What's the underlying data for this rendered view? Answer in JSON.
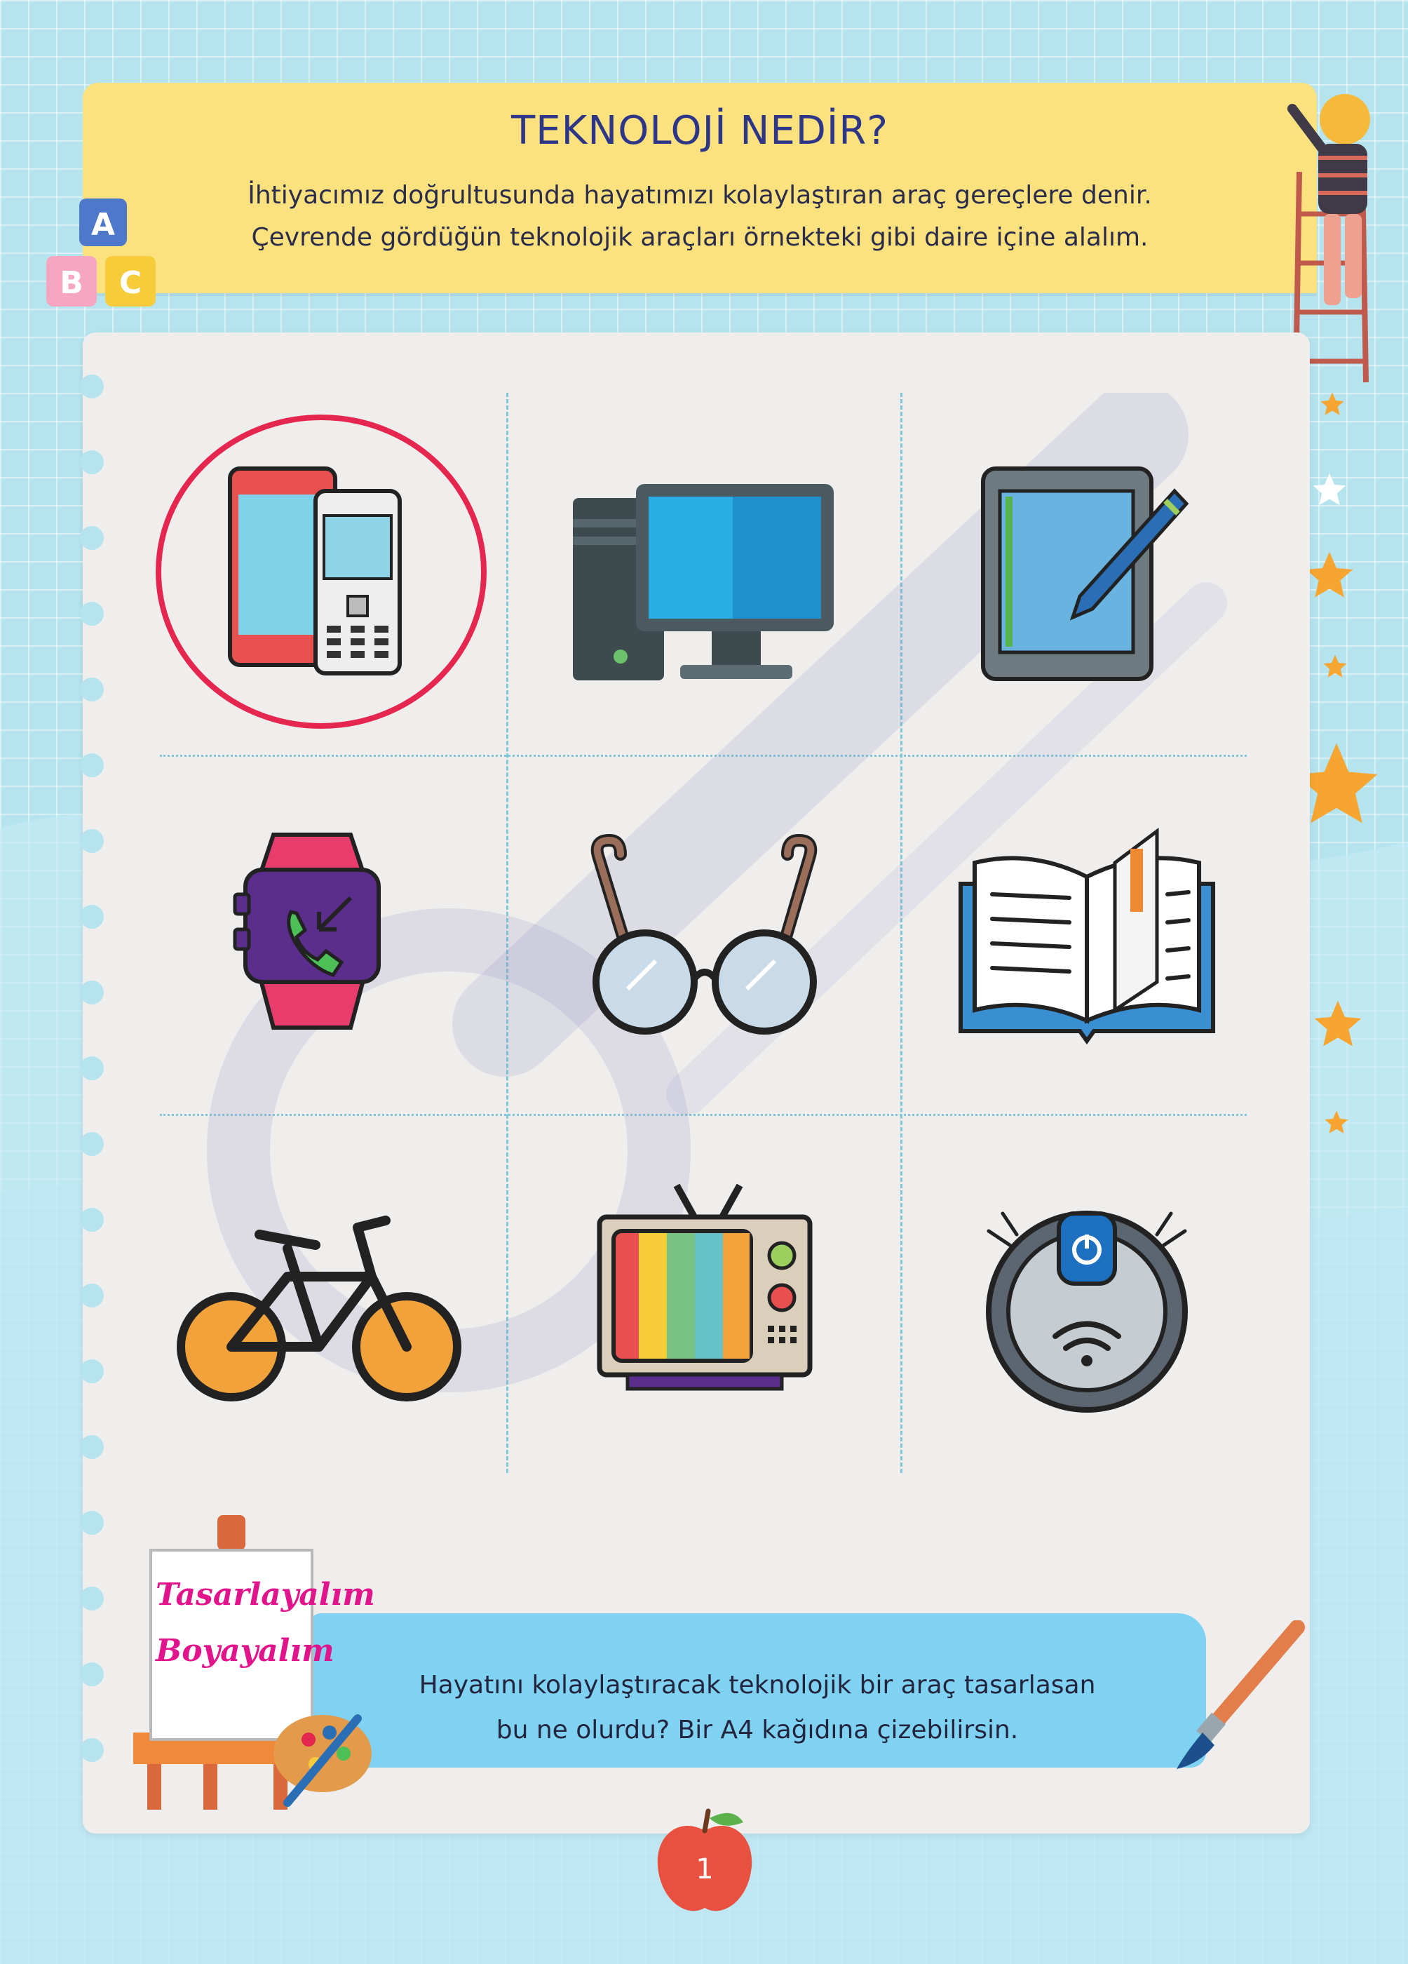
{
  "header": {
    "title": "TEKNOLOJİ NEDİR?",
    "line1": "İhtiyacımız doğrultusunda hayatımızı kolaylaştıran araç gereçlere denir.",
    "line2": "Çevrende gördüğün teknolojik araçları örnekteki gibi daire içine alalım."
  },
  "blocks": {
    "letters": [
      "A",
      "B",
      "C"
    ]
  },
  "items": [
    {
      "name": "mobile-phones",
      "circled": true
    },
    {
      "name": "desktop-computer",
      "circled": false
    },
    {
      "name": "graphics-tablet",
      "circled": false
    },
    {
      "name": "smartwatch",
      "circled": false
    },
    {
      "name": "eyeglasses",
      "circled": false
    },
    {
      "name": "open-book",
      "circled": false
    },
    {
      "name": "bicycle",
      "circled": false
    },
    {
      "name": "television",
      "circled": false
    },
    {
      "name": "robot-vacuum",
      "circled": false
    }
  ],
  "activity": {
    "easel_word1": "Tasarlayalım",
    "easel_word2": "Boyayalım",
    "line1": "Hayatını kolaylaştıracak teknolojik bir araç tasarlasan",
    "line2": "bu ne olurdu? Bir A4 kağıdına çizebilirsin."
  },
  "page_number": "1",
  "colors": {
    "background": "#b5e3ee",
    "banner": "#fbe27f",
    "paper": "#efeeed",
    "title": "#2d3687",
    "example_circle": "#e5264f",
    "easel_text": "#e2148b"
  }
}
